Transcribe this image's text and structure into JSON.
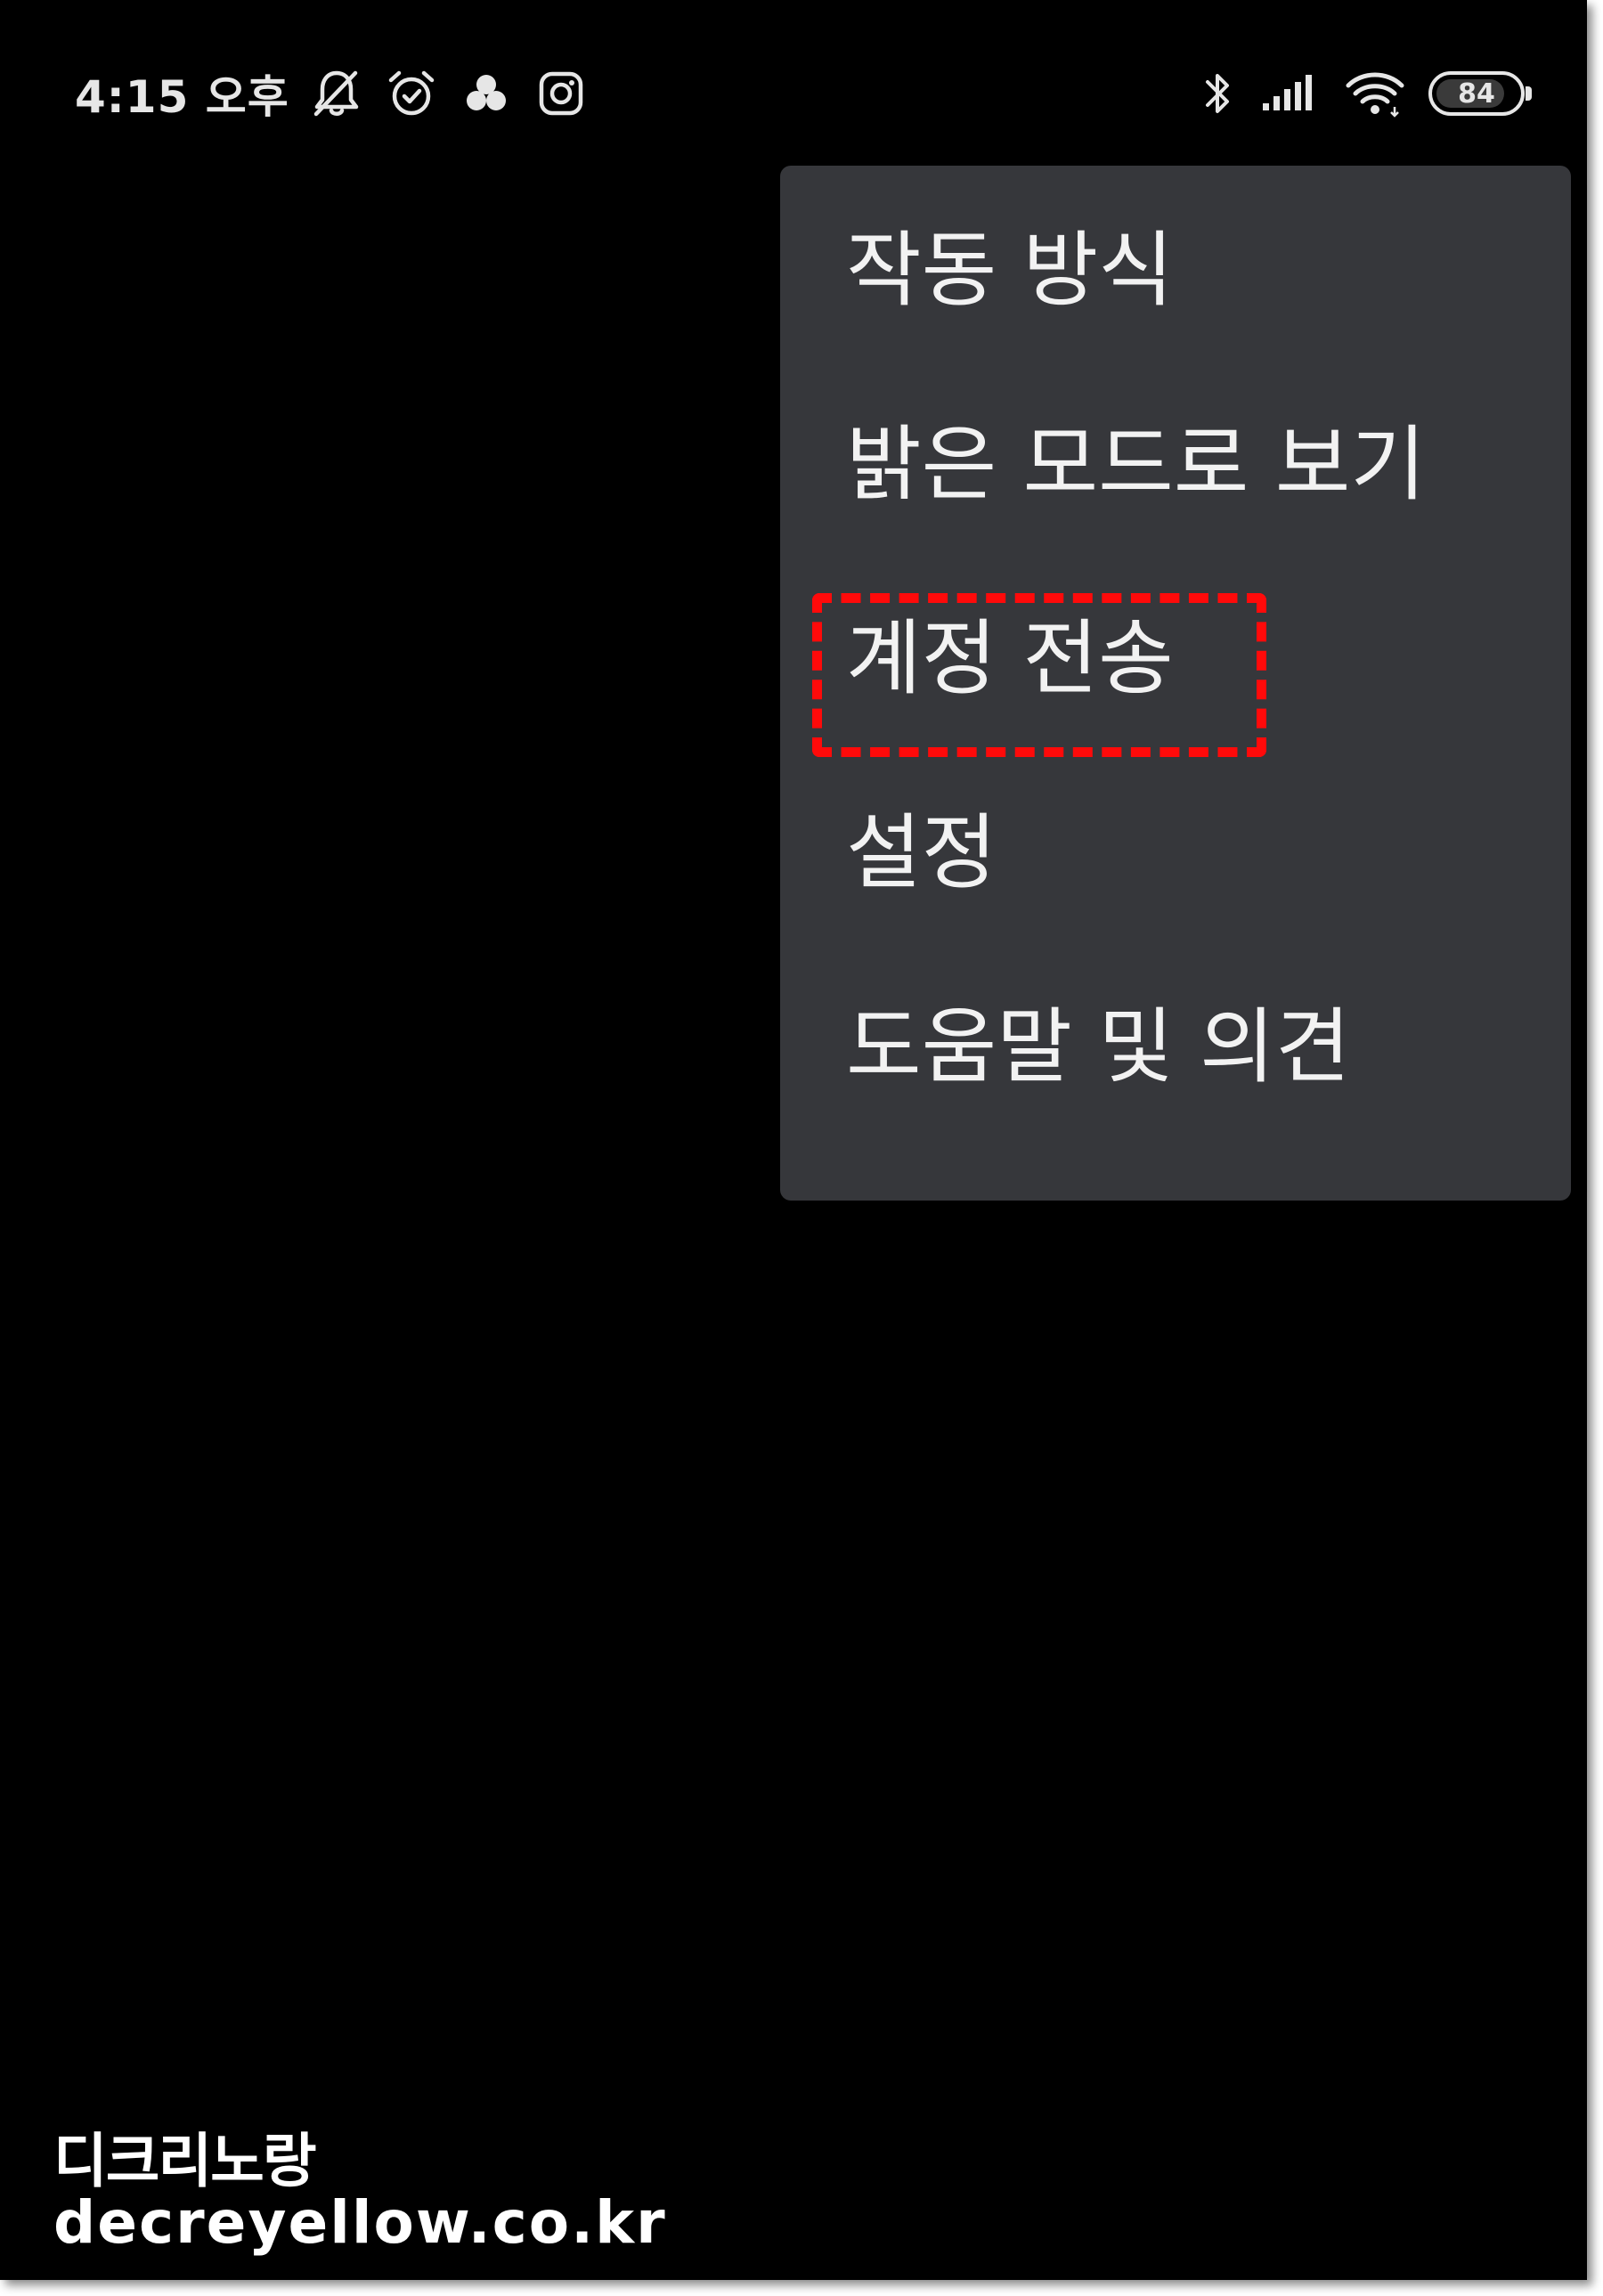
{
  "status_bar": {
    "time": "4:15 오후",
    "icons_left": [
      "bell-off-icon",
      "alarm-clock-icon",
      "app-bubbles-icon",
      "instagram-icon"
    ],
    "icons_right": [
      "bluetooth-icon",
      "cellular-signal-icon",
      "wifi-icon"
    ],
    "battery_level": "84",
    "battery_fraction": 0.84
  },
  "menu": {
    "items": [
      {
        "label": "작동 방식"
      },
      {
        "label": "밝은 모드로 보기"
      },
      {
        "label": "계정 전송",
        "highlighted": true
      },
      {
        "label": "설정"
      },
      {
        "label": "도움말 및 의견"
      }
    ],
    "background_color": "#36373b",
    "highlight_color": "#ff0a0a"
  },
  "watermark": {
    "line1": "디크리노랑",
    "line2": "decreyellow.co.kr"
  }
}
